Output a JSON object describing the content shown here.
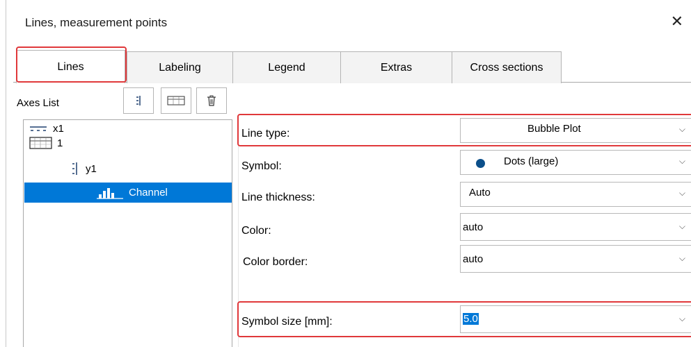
{
  "window": {
    "title": "Lines, measurement points",
    "close_glyph": "✕"
  },
  "tabs": [
    {
      "label": "Lines",
      "active": true
    },
    {
      "label": "Labeling"
    },
    {
      "label": "Legend"
    },
    {
      "label": "Extras"
    },
    {
      "label": "Cross sections"
    }
  ],
  "axes": {
    "label": "Axes List",
    "toolbar": [
      {
        "icon": "axis-icon"
      },
      {
        "icon": "grid-icon"
      },
      {
        "icon": "trash-icon"
      }
    ],
    "tree": [
      {
        "label": "x1",
        "icon": "x-axis-icon"
      },
      {
        "label": "1",
        "icon": "table-icon"
      },
      {
        "label": "y1",
        "icon": "y-axis-icon"
      },
      {
        "label": "Channel",
        "icon": "histogram-icon",
        "selected": true
      }
    ]
  },
  "fields": {
    "line_type": {
      "label": "Line type:",
      "value": "Bubble Plot"
    },
    "symbol": {
      "label": "Symbol:",
      "value": "Dots (large)",
      "dot_color": "#0b4f8a"
    },
    "line_thickness": {
      "label": "Line thickness:",
      "value": "Auto"
    },
    "color": {
      "label": "Color:",
      "value": "auto"
    },
    "color_border": {
      "label": "Color border:",
      "value": "auto"
    },
    "symbol_size": {
      "label": "Symbol size [mm]:",
      "value": "5.0"
    }
  },
  "colors": {
    "highlight": "#e0383a",
    "selection": "#0078d7"
  }
}
